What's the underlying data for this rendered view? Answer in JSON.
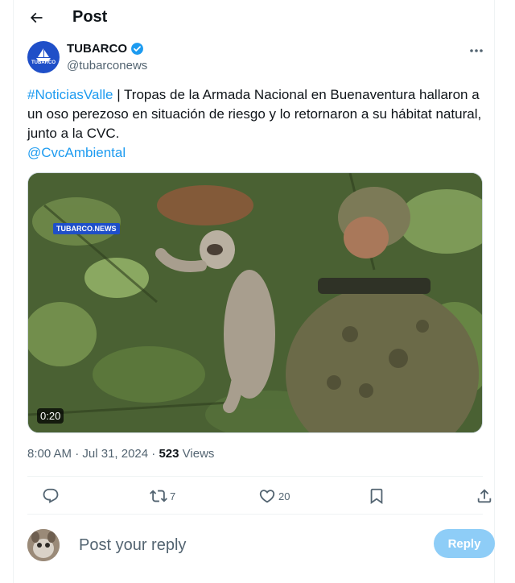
{
  "header": {
    "title": "Post"
  },
  "author": {
    "name": "TUBARCO",
    "handle": "@tubarconews",
    "avatar_text": "TUBARCO",
    "verified": true
  },
  "tweet": {
    "hashtag": "#NoticiasValle",
    "body": " | Tropas de la Armada Nacional en Buenaventura hallaron a un oso perezoso en situación de riesgo y lo retornaron a su hábitat natural, junto a la CVC.",
    "mention": "@CvcAmbiental"
  },
  "media": {
    "watermark": "TUBARCO.NEWS",
    "duration": "0:20",
    "icon": "video-thumbnail"
  },
  "meta": {
    "time": "8:00 AM",
    "separator": "·",
    "date": "Jul 31, 2024",
    "views_count": "523",
    "views_label": "Views"
  },
  "actions": {
    "reply_count": "",
    "retweet_count": "7",
    "like_count": "20"
  },
  "reply": {
    "placeholder": "Post your reply",
    "button_label": "Reply"
  },
  "colors": {
    "accent": "#1d9bf0",
    "reply_button_disabled": "#8ecdf7",
    "secondary_text": "#536471",
    "brand": "#1f4fc8"
  }
}
